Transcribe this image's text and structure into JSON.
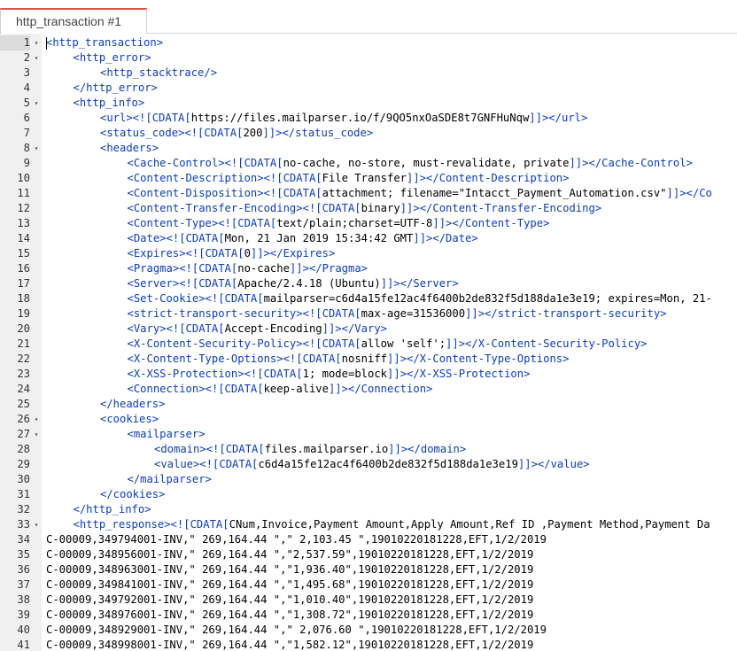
{
  "tab": {
    "title": "http_transaction #1"
  },
  "fold_glyph": "▾",
  "lines": [
    {
      "n": "1",
      "fold": true,
      "indent": 0,
      "parts": [
        {
          "t": "tag",
          "v": "<http_transaction>"
        }
      ]
    },
    {
      "n": "2",
      "fold": true,
      "indent": 1,
      "parts": [
        {
          "t": "tag",
          "v": "<http_error>"
        }
      ]
    },
    {
      "n": "3",
      "indent": 2,
      "parts": [
        {
          "t": "tag",
          "v": "<http_stacktrace/>"
        }
      ]
    },
    {
      "n": "4",
      "indent": 1,
      "parts": [
        {
          "t": "tag",
          "v": "</http_error>"
        }
      ]
    },
    {
      "n": "5",
      "fold": true,
      "indent": 1,
      "parts": [
        {
          "t": "tag",
          "v": "<http_info>"
        }
      ]
    },
    {
      "n": "6",
      "indent": 2,
      "parts": [
        {
          "t": "tag",
          "v": "<url><![CDATA["
        },
        {
          "t": "cd",
          "v": "https://files.mailparser.io/f/9QO5nxOaSDE8t7GNFHuNqw"
        },
        {
          "t": "tag",
          "v": "]]></url>"
        }
      ]
    },
    {
      "n": "7",
      "indent": 2,
      "parts": [
        {
          "t": "tag",
          "v": "<status_code><![CDATA["
        },
        {
          "t": "cd",
          "v": "200"
        },
        {
          "t": "tag",
          "v": "]]></status_code>"
        }
      ]
    },
    {
      "n": "8",
      "fold": true,
      "indent": 2,
      "parts": [
        {
          "t": "tag",
          "v": "<headers>"
        }
      ]
    },
    {
      "n": "9",
      "indent": 3,
      "parts": [
        {
          "t": "tag",
          "v": "<Cache-Control><![CDATA["
        },
        {
          "t": "cd",
          "v": "no-cache, no-store, must-revalidate, private"
        },
        {
          "t": "tag",
          "v": "]]></Cache-Control>"
        }
      ]
    },
    {
      "n": "10",
      "indent": 3,
      "parts": [
        {
          "t": "tag",
          "v": "<Content-Description><![CDATA["
        },
        {
          "t": "cd",
          "v": "File Transfer"
        },
        {
          "t": "tag",
          "v": "]]></Content-Description>"
        }
      ]
    },
    {
      "n": "11",
      "indent": 3,
      "parts": [
        {
          "t": "tag",
          "v": "<Content-Disposition><![CDATA["
        },
        {
          "t": "cd",
          "v": "attachment; filename=\"Intacct_Payment_Automation.csv\""
        },
        {
          "t": "tag",
          "v": "]]></Co"
        }
      ]
    },
    {
      "n": "12",
      "indent": 3,
      "parts": [
        {
          "t": "tag",
          "v": "<Content-Transfer-Encoding><![CDATA["
        },
        {
          "t": "cd",
          "v": "binary"
        },
        {
          "t": "tag",
          "v": "]]></Content-Transfer-Encoding>"
        }
      ]
    },
    {
      "n": "13",
      "indent": 3,
      "parts": [
        {
          "t": "tag",
          "v": "<Content-Type><![CDATA["
        },
        {
          "t": "cd",
          "v": "text/plain;charset=UTF-8"
        },
        {
          "t": "tag",
          "v": "]]></Content-Type>"
        }
      ]
    },
    {
      "n": "14",
      "indent": 3,
      "parts": [
        {
          "t": "tag",
          "v": "<Date><![CDATA["
        },
        {
          "t": "cd",
          "v": "Mon, 21 Jan 2019 15:34:42 GMT"
        },
        {
          "t": "tag",
          "v": "]]></Date>"
        }
      ]
    },
    {
      "n": "15",
      "indent": 3,
      "parts": [
        {
          "t": "tag",
          "v": "<Expires><![CDATA["
        },
        {
          "t": "cd",
          "v": "0"
        },
        {
          "t": "tag",
          "v": "]]></Expires>"
        }
      ]
    },
    {
      "n": "16",
      "indent": 3,
      "parts": [
        {
          "t": "tag",
          "v": "<Pragma><![CDATA["
        },
        {
          "t": "cd",
          "v": "no-cache"
        },
        {
          "t": "tag",
          "v": "]]></Pragma>"
        }
      ]
    },
    {
      "n": "17",
      "indent": 3,
      "parts": [
        {
          "t": "tag",
          "v": "<Server><![CDATA["
        },
        {
          "t": "cd",
          "v": "Apache/2.4.18 (Ubuntu)"
        },
        {
          "t": "tag",
          "v": "]]></Server>"
        }
      ]
    },
    {
      "n": "18",
      "indent": 3,
      "parts": [
        {
          "t": "tag",
          "v": "<Set-Cookie><![CDATA["
        },
        {
          "t": "cd",
          "v": "mailparser=c6d4a15fe12ac4f6400b2de832f5d188da1e3e19; expires=Mon, 21-"
        }
      ]
    },
    {
      "n": "19",
      "indent": 3,
      "parts": [
        {
          "t": "tag",
          "v": "<strict-transport-security><![CDATA["
        },
        {
          "t": "cd",
          "v": "max-age=31536000"
        },
        {
          "t": "tag",
          "v": "]]></strict-transport-security>"
        }
      ]
    },
    {
      "n": "20",
      "indent": 3,
      "parts": [
        {
          "t": "tag",
          "v": "<Vary><![CDATA["
        },
        {
          "t": "cd",
          "v": "Accept-Encoding"
        },
        {
          "t": "tag",
          "v": "]]></Vary>"
        }
      ]
    },
    {
      "n": "21",
      "indent": 3,
      "parts": [
        {
          "t": "tag",
          "v": "<X-Content-Security-Policy><![CDATA["
        },
        {
          "t": "cd",
          "v": "allow 'self';"
        },
        {
          "t": "tag",
          "v": "]]></X-Content-Security-Policy>"
        }
      ]
    },
    {
      "n": "22",
      "indent": 3,
      "parts": [
        {
          "t": "tag",
          "v": "<X-Content-Type-Options><![CDATA["
        },
        {
          "t": "cd",
          "v": "nosniff"
        },
        {
          "t": "tag",
          "v": "]]></X-Content-Type-Options>"
        }
      ]
    },
    {
      "n": "23",
      "indent": 3,
      "parts": [
        {
          "t": "tag",
          "v": "<X-XSS-Protection><![CDATA["
        },
        {
          "t": "cd",
          "v": "1; mode=block"
        },
        {
          "t": "tag",
          "v": "]]></X-XSS-Protection>"
        }
      ]
    },
    {
      "n": "24",
      "indent": 3,
      "parts": [
        {
          "t": "tag",
          "v": "<Connection><![CDATA["
        },
        {
          "t": "cd",
          "v": "keep-alive"
        },
        {
          "t": "tag",
          "v": "]]></Connection>"
        }
      ]
    },
    {
      "n": "25",
      "indent": 2,
      "parts": [
        {
          "t": "tag",
          "v": "</headers>"
        }
      ]
    },
    {
      "n": "26",
      "fold": true,
      "indent": 2,
      "parts": [
        {
          "t": "tag",
          "v": "<cookies>"
        }
      ]
    },
    {
      "n": "27",
      "fold": true,
      "indent": 3,
      "parts": [
        {
          "t": "tag",
          "v": "<mailparser>"
        }
      ]
    },
    {
      "n": "28",
      "indent": 4,
      "parts": [
        {
          "t": "tag",
          "v": "<domain><![CDATA["
        },
        {
          "t": "cd",
          "v": "files.mailparser.io"
        },
        {
          "t": "tag",
          "v": "]]></domain>"
        }
      ]
    },
    {
      "n": "29",
      "indent": 4,
      "parts": [
        {
          "t": "tag",
          "v": "<value><![CDATA["
        },
        {
          "t": "cd",
          "v": "c6d4a15fe12ac4f6400b2de832f5d188da1e3e19"
        },
        {
          "t": "tag",
          "v": "]]></value>"
        }
      ]
    },
    {
      "n": "30",
      "indent": 3,
      "parts": [
        {
          "t": "tag",
          "v": "</mailparser>"
        }
      ]
    },
    {
      "n": "31",
      "indent": 2,
      "parts": [
        {
          "t": "tag",
          "v": "</cookies>"
        }
      ]
    },
    {
      "n": "32",
      "indent": 1,
      "parts": [
        {
          "t": "tag",
          "v": "</http_info>"
        }
      ]
    },
    {
      "n": "33",
      "fold": true,
      "indent": 1,
      "parts": [
        {
          "t": "tag",
          "v": "<http_response><![CDATA["
        },
        {
          "t": "cd",
          "v": "CNum,Invoice,Payment Amount,Apply Amount,Ref ID ,Payment Method,Payment Da"
        }
      ]
    },
    {
      "n": "34",
      "indent": 0,
      "parts": [
        {
          "t": "cd",
          "v": "C-00009,349794001-INV,\" 269,164.44 \",\" 2,103.45 \",19010220181228,EFT,1/2/2019"
        }
      ]
    },
    {
      "n": "35",
      "indent": 0,
      "parts": [
        {
          "t": "cd",
          "v": "C-00009,348956001-INV,\" 269,164.44 \",\"2,537.59\",19010220181228,EFT,1/2/2019"
        }
      ]
    },
    {
      "n": "36",
      "indent": 0,
      "parts": [
        {
          "t": "cd",
          "v": "C-00009,348963001-INV,\" 269,164.44 \",\"1,936.40\",19010220181228,EFT,1/2/2019"
        }
      ]
    },
    {
      "n": "37",
      "indent": 0,
      "parts": [
        {
          "t": "cd",
          "v": "C-00009,349841001-INV,\" 269,164.44 \",\"1,495.68\",19010220181228,EFT,1/2/2019"
        }
      ]
    },
    {
      "n": "38",
      "indent": 0,
      "parts": [
        {
          "t": "cd",
          "v": "C-00009,349792001-INV,\" 269,164.44 \",\"1,010.40\",19010220181228,EFT,1/2/2019"
        }
      ]
    },
    {
      "n": "39",
      "indent": 0,
      "parts": [
        {
          "t": "cd",
          "v": "C-00009,348976001-INV,\" 269,164.44 \",\"1,308.72\",19010220181228,EFT,1/2/2019"
        }
      ]
    },
    {
      "n": "40",
      "indent": 0,
      "parts": [
        {
          "t": "cd",
          "v": "C-00009,348929001-INV,\" 269,164.44 \",\" 2,076.60 \",19010220181228,EFT,1/2/2019"
        }
      ]
    },
    {
      "n": "41",
      "indent": 0,
      "parts": [
        {
          "t": "cd",
          "v": "C-00009,348998001-INV,\" 269,164.44 \",\"1,582.12\",19010220181228,EFT,1/2/2019"
        }
      ]
    }
  ]
}
